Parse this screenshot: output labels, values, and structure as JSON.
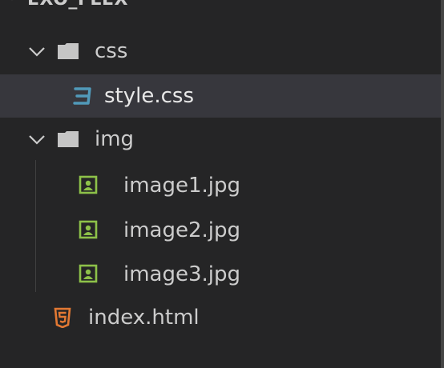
{
  "explorer": {
    "root_label": "EXO_FLEX",
    "items": [
      {
        "label": "css",
        "kind": "folder",
        "expanded": true
      },
      {
        "label": "style.css",
        "kind": "css-file",
        "selected": true
      },
      {
        "label": "img",
        "kind": "folder",
        "expanded": true
      },
      {
        "label": "image1.jpg",
        "kind": "image-file"
      },
      {
        "label": "image2.jpg",
        "kind": "image-file"
      },
      {
        "label": "image3.jpg",
        "kind": "image-file"
      },
      {
        "label": "index.html",
        "kind": "html-file"
      }
    ]
  },
  "colors": {
    "background": "#252526",
    "selected_row": "#37373d",
    "text": "#cccccc",
    "css_icon": "#519aba",
    "image_icon": "#8dc149",
    "html_icon": "#e37933"
  },
  "icons": {
    "chevron": "chevron-down-icon",
    "folder": "folder-icon",
    "css": "css-file-icon",
    "image": "image-file-icon",
    "html": "html-file-icon"
  }
}
